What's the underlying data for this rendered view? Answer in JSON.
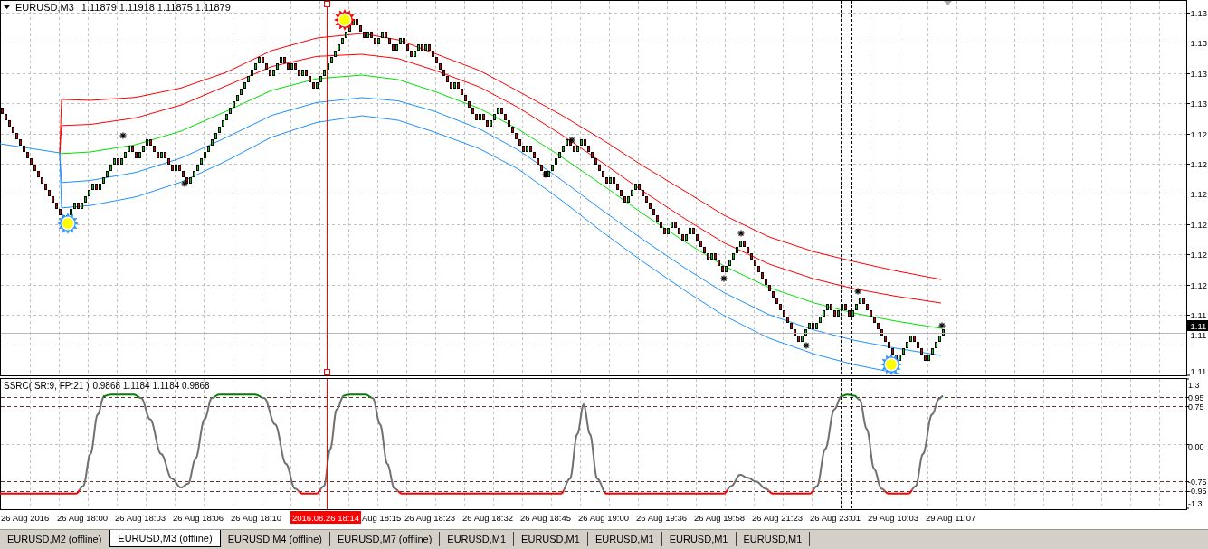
{
  "chart": {
    "symbol": "EURUSD,M3",
    "prices": "1.11879 1.11918 1.11875 1.11879",
    "price_axis_labels": [
      "1.13",
      "1.13",
      "1.13",
      "1.13",
      "1.12",
      "1.12",
      "1.12",
      "1.12",
      "1.12",
      "1.12",
      "1.11",
      "1.11",
      "1.11"
    ],
    "current_price": "1.11"
  },
  "indicator": {
    "name": "SSRC( SR:9, FP:21 )",
    "values": "0.9868 1.1184 1.1184 0.9868",
    "axis_labels": [
      "1.3",
      "0.95",
      "0.75",
      "0.00",
      "-0.75",
      "-0.95",
      "-1.3"
    ]
  },
  "time_axis": {
    "labels": [
      "26 Aug 2016",
      "26 Aug 18:00",
      "26 Aug 18:03",
      "26 Aug 18:06",
      "26 Aug 18:10",
      "Aug 18:15",
      "26 Aug 18:23",
      "26 Aug 18:32",
      "26 Aug 18:45",
      "26 Aug 19:00",
      "26 Aug 19:36",
      "26 Aug 19:58",
      "26 Aug 21:23",
      "26 Aug 23:01",
      "29 Aug 10:03",
      "29 Aug 11:07"
    ],
    "cursor_label": "2016.08.26 18:14"
  },
  "tabs": [
    {
      "label": "EURUSD,M2 (offline)",
      "selected": false
    },
    {
      "label": "EURUSD,M3 (offline)",
      "selected": true
    },
    {
      "label": "EURUSD,M4 (offline)",
      "selected": false
    },
    {
      "label": "EURUSD,M7 (offline)",
      "selected": false
    },
    {
      "label": "EURUSD,M1",
      "selected": false
    },
    {
      "label": "EURUSD,M1",
      "selected": false
    },
    {
      "label": "EURUSD,M1",
      "selected": false
    },
    {
      "label": "EURUSD,M1",
      "selected": false
    },
    {
      "label": "EURUSD,M1",
      "selected": false
    }
  ]
}
